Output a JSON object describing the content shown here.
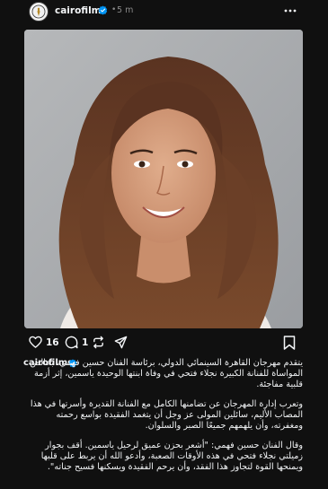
{
  "post": {
    "username": "cairofilms",
    "time": "5 m",
    "separator": "•"
  },
  "actions": {
    "likes": "16",
    "comments": "1"
  },
  "caption": {
    "username": "cairofilms",
    "paragraphs": [
      "يتقدم مهرجان القاهرة السينمائي الدولي، برئاسة الفنان حسين فهمي، بخالص المواساة للفنانة الكبيرة نجلاء فتحي في وفاة ابنتها الوحيدة ياسمين، إثر أزمة قلبية مفاجئة.",
      "وتعرب إدارة المهرجان عن تضامنها الكامل مع الفنانة القديرة وأسرتها في هذا المصاب الأليم، سائلين المولى عز وجل أن يتغمد الفقيدة بواسع رحمته ومغفرته، وأن يلهمهم جميعًا الصبر والسلوان.",
      "وقال الفنان حسين فهمي: \"أشعر بحزن عميق لرحيل ياسمين. أقف بجوار زميلتي نجلاء فتحي في هذه الأوقات الصعبة، وأدعو الله أن يربط على قلبها ويمنحها القوة لتجاوز هذا الفقد، وأن يرحم الفقيدة ويسكنها فسيح جناته\"."
    ]
  },
  "icons": {
    "avatar": "cairo-film-festival-logo",
    "verified": "verified-badge-icon",
    "more": "more-options-icon",
    "like": "heart-icon",
    "comment": "comment-icon",
    "repost": "repost-icon",
    "share": "share-icon",
    "save": "bookmark-icon"
  },
  "colors": {
    "background": "#101010",
    "text": "#f3f5f7",
    "muted": "#8a8a8a",
    "verified": "#0095f6"
  }
}
